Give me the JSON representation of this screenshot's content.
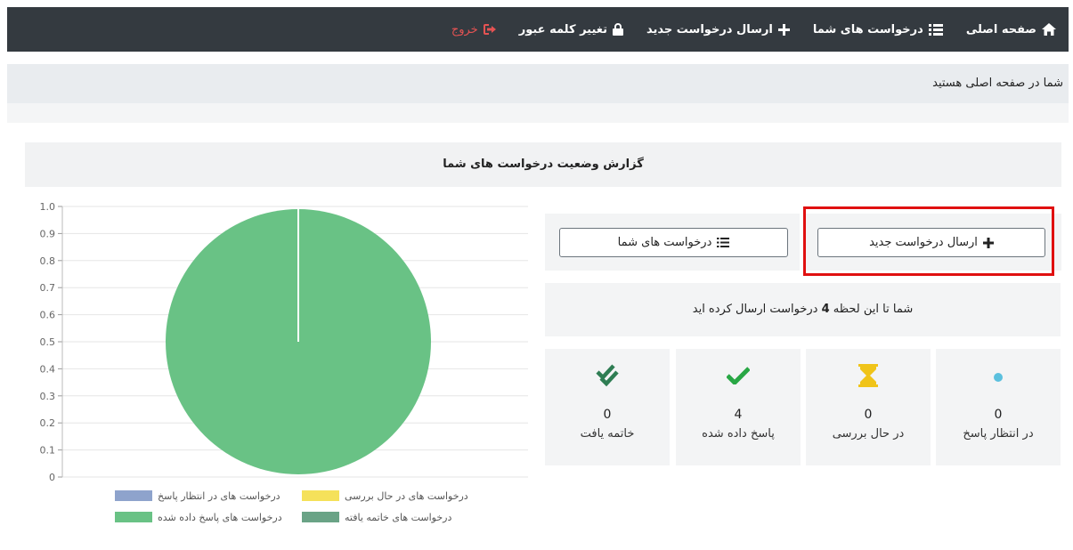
{
  "nav": {
    "home": "صفحه اصلی",
    "my_requests": "درخواست های شما",
    "new_request": "ارسال درخواست جدید",
    "change_password": "تغییر کلمه عبور",
    "logout": "خروج"
  },
  "breadcrumb": "شما در صفحه اصلی هستید",
  "report_title": "گزارش وضعیت درخواست های شما",
  "buttons": {
    "new_request": "ارسال درخواست جدید",
    "my_requests": "درخواست های شما"
  },
  "info": {
    "before": "شما تا این لحظه",
    "count": "4",
    "after": "درخواست ارسال کرده اید"
  },
  "stats": [
    {
      "value": "0",
      "label": "در انتظار پاسخ"
    },
    {
      "value": "0",
      "label": "در حال بررسی"
    },
    {
      "value": "4",
      "label": "پاسخ داده شده"
    },
    {
      "value": "0",
      "label": "خاتمه یافت"
    }
  ],
  "colors": {
    "navbar": "#343a40",
    "logout": "#e55353",
    "highlight": "#e01010",
    "icon_waiting": "#5bc0de",
    "icon_review": "#f0c419",
    "icon_answered": "#28a745",
    "icon_closed": "#2e7d53"
  },
  "chart_data": {
    "type": "pie",
    "yticks": [
      "0",
      "0.1",
      "0.2",
      "0.3",
      "0.4",
      "0.5",
      "0.6",
      "0.7",
      "0.8",
      "0.9",
      "1.0"
    ],
    "ylim": [
      0,
      1
    ],
    "series": [
      {
        "name": "درخواست های در انتظار پاسخ",
        "value": 0,
        "color": "#8ea3cc"
      },
      {
        "name": "درخواست های در حال بررسی",
        "value": 0,
        "color": "#f5e15a"
      },
      {
        "name": "درخواست های پاسخ داده شده",
        "value": 4,
        "color": "#69c285"
      },
      {
        "name": "درخواست های خاتمه یافته",
        "value": 0,
        "color": "#6aa386"
      }
    ]
  }
}
